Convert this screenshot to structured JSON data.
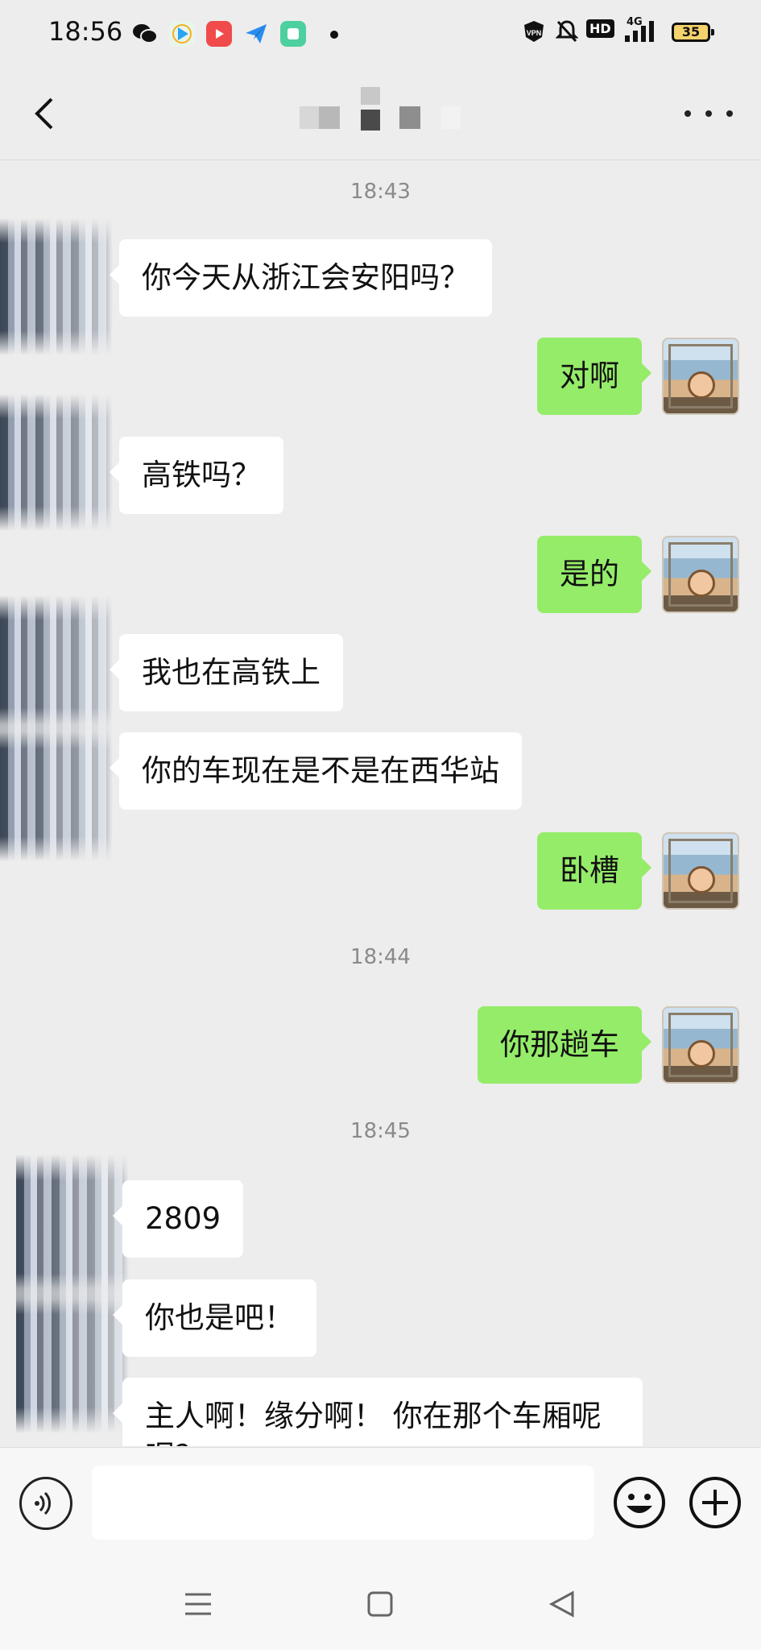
{
  "status_bar": {
    "time": "18:56",
    "app_icons": [
      "wechat-icon",
      "video-app-icon",
      "red-play-icon",
      "paper-plane-icon",
      "green-square-icon"
    ],
    "indicators": [
      "vpn-icon",
      "mute-bell-icon",
      "hd-icon",
      "4g-signal-icon"
    ],
    "vpn_label": "VPN",
    "hd_label": "HD",
    "network_label": "4G",
    "battery_level": "35"
  },
  "header": {
    "contact_name": "",
    "back_icon": "chevron-left-icon",
    "more_icon": "more-dots-icon"
  },
  "chat": {
    "messages": [
      {
        "type": "timestamp",
        "text": "18:43"
      },
      {
        "type": "in",
        "text": "你今天从浙江会安阳吗？"
      },
      {
        "type": "out",
        "text": "对啊"
      },
      {
        "type": "in",
        "text": "高铁吗？"
      },
      {
        "type": "out",
        "text": "是的"
      },
      {
        "type": "in",
        "text": "我也在高铁上"
      },
      {
        "type": "in",
        "text": "你的车现在是不是在西华站"
      },
      {
        "type": "out",
        "text": "卧槽"
      },
      {
        "type": "timestamp",
        "text": "18:44"
      },
      {
        "type": "out",
        "text": "你那趟车"
      },
      {
        "type": "timestamp",
        "text": "18:45"
      },
      {
        "type": "in",
        "text": "2809"
      },
      {
        "type": "in",
        "text": "你也是吧！"
      },
      {
        "type": "in",
        "text": "主人啊！缘分啊！ 你在那个车厢呢 呢？"
      }
    ]
  },
  "input_bar": {
    "voice_icon": "voice-icon",
    "emoji_icon": "emoji-icon",
    "plus_icon": "plus-icon",
    "text_value": ""
  },
  "nav_bar": {
    "icons": [
      "menu-icon",
      "home-square-icon",
      "back-triangle-icon"
    ]
  },
  "colors": {
    "background": "#ededed",
    "outgoing_bubble": "#95ec69",
    "incoming_bubble": "#ffffff",
    "timestamp_text": "#8a8a8a"
  }
}
